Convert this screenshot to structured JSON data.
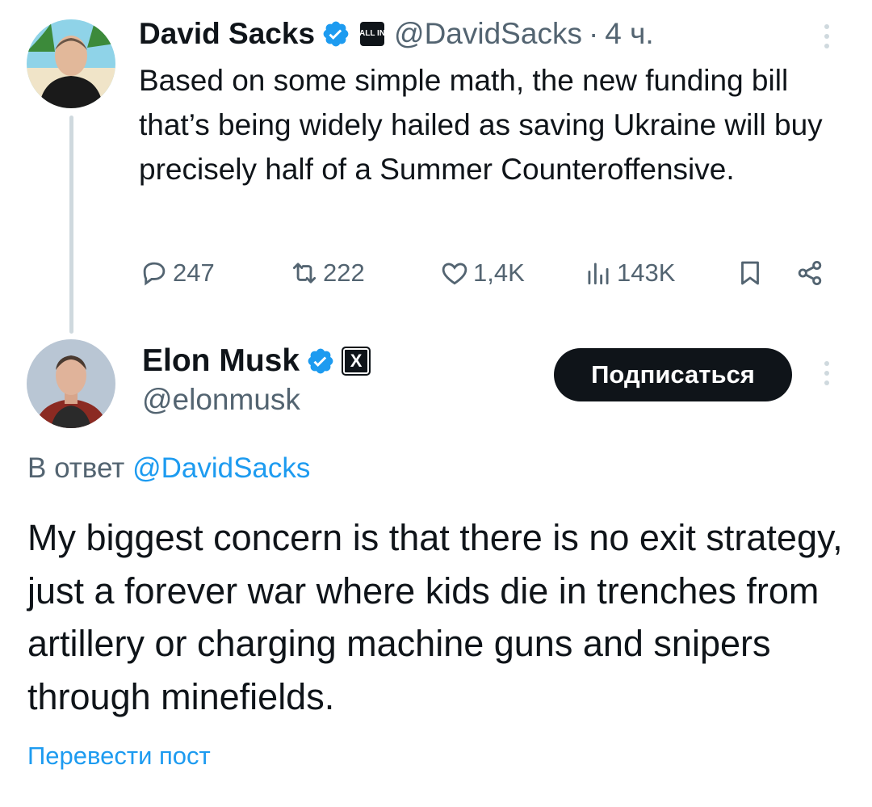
{
  "parent_tweet": {
    "author_name": "David Sacks",
    "affiliate_badge": "ALL IN",
    "handle": "@DavidSacks",
    "separator": "·",
    "time": "4 ч.",
    "text": "Based on some simple math, the new funding bill that’s being widely hailed as saving Ukraine will buy precisely half of a Summer Counteroffensive.",
    "stats": {
      "replies": "247",
      "reposts": "222",
      "likes": "1,4K",
      "views": "143K"
    },
    "icons": {
      "verified": "verified-badge-icon",
      "reply": "reply-icon",
      "repost": "repost-icon",
      "like": "heart-icon",
      "views": "views-icon",
      "bookmark": "bookmark-icon",
      "share": "share-icon",
      "more": "more-vertical-icon"
    }
  },
  "reply_tweet": {
    "author_name": "Elon Musk",
    "affiliate_badge": "X",
    "handle": "@elonmusk",
    "follow_label": "Подписаться",
    "reply_to_prefix": "В ответ",
    "reply_to_handle": "@DavidSacks",
    "text": "My biggest concern is that there is no exit strategy, just a forever war where kids die in trenches from artillery or charging machine guns and snipers through minefields.",
    "translate_label": "Перевести пост"
  },
  "colors": {
    "text": "#0f1419",
    "secondary": "#536471",
    "link": "#1d9bf0",
    "verified": "#1d9bf0",
    "thread_line": "#cfd9de",
    "button_bg": "#0f1419"
  }
}
